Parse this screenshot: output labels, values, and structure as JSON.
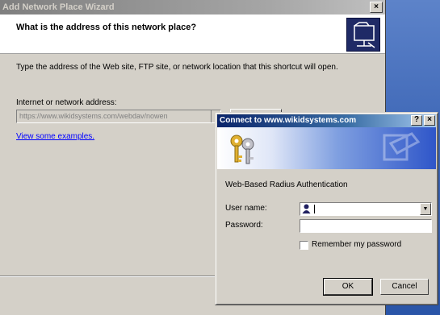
{
  "wizard": {
    "title": "Add Network Place Wizard",
    "close_label": "×",
    "heading": "What is the address of this network place?",
    "instruction": "Type the address of the Web site, FTP site, or network location that this shortcut will open.",
    "address_label": "Internet or network address:",
    "address_value": "https://www.wikidsystems.com/webdav/nowen",
    "examples_link": "View some examples."
  },
  "dialog": {
    "title": "Connect to www.wikidsystems.com",
    "help_label": "?",
    "close_label": "×",
    "realm": "Web-Based Radius Authentication",
    "username_label": "User name:",
    "username_value": "",
    "password_label": "Password:",
    "password_value": "",
    "remember_label": "Remember my password",
    "remember_checked": false,
    "ok_label": "OK",
    "cancel_label": "Cancel"
  },
  "colors": {
    "dialog_title_start": "#0a246a",
    "dialog_title_end": "#a6caf0",
    "link": "#0000ff"
  },
  "icons": [
    "network-folder-icon",
    "keys-icon",
    "user-icon",
    "dropdown-arrow-icon"
  ]
}
